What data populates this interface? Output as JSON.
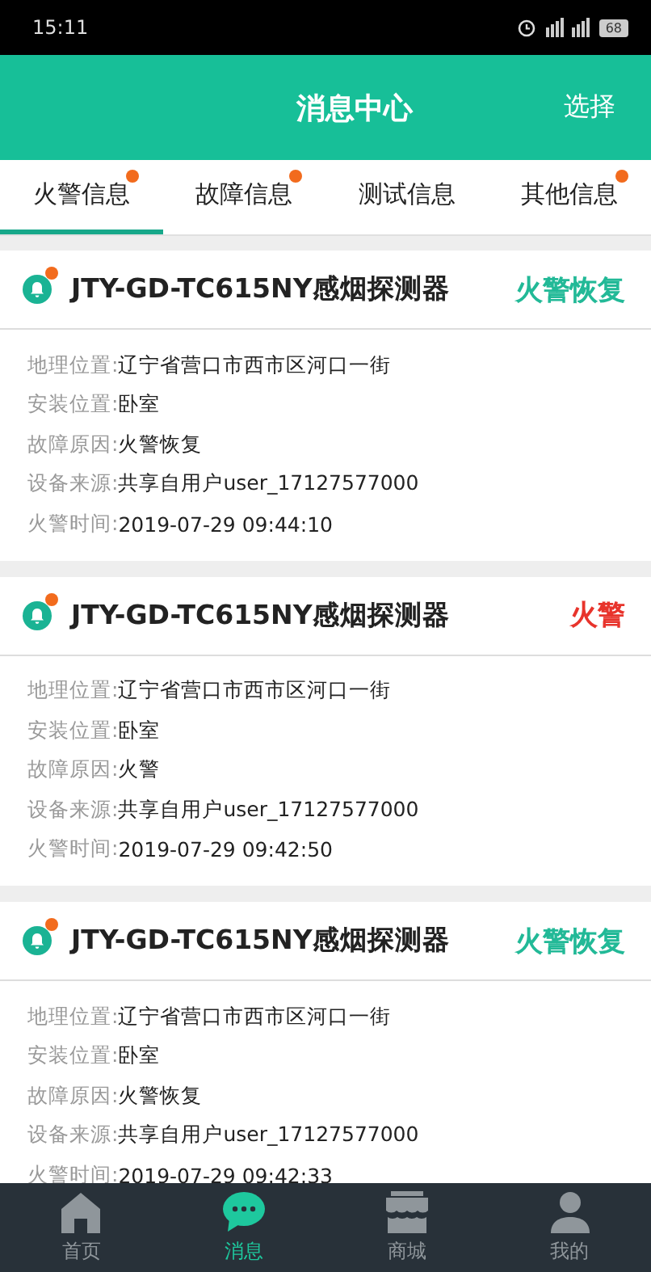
{
  "status_bar": {
    "time": "15:11",
    "battery": "68"
  },
  "header": {
    "title": "消息中心",
    "action": "选择"
  },
  "tabs": [
    {
      "label": "火警信息",
      "selected": true,
      "badge": true
    },
    {
      "label": "故障信息",
      "selected": false,
      "badge": true
    },
    {
      "label": "测试信息",
      "selected": false,
      "badge": false
    },
    {
      "label": "其他信息",
      "selected": false,
      "badge": true
    }
  ],
  "messages": [
    {
      "device": "JTY-GD-TC615NY感烟探测器",
      "unread": true,
      "status": "火警恢复",
      "kind": "restore",
      "fields": [
        {
          "label": "地理位置:",
          "value": "辽宁省营口市西市区河口一街"
        },
        {
          "label": "安装位置:",
          "value": "卧室"
        },
        {
          "label": "故障原因:",
          "value": "火警恢复"
        },
        {
          "label": "设备来源:",
          "value": "共享自用户user_17127577000"
        },
        {
          "label": "火警时间:",
          "value": "2019-07-29 09:44:10"
        }
      ]
    },
    {
      "device": "JTY-GD-TC615NY感烟探测器",
      "unread": true,
      "status": "火警",
      "kind": "alarm",
      "fields": [
        {
          "label": "地理位置:",
          "value": "辽宁省营口市西市区河口一街"
        },
        {
          "label": "安装位置:",
          "value": "卧室"
        },
        {
          "label": "故障原因:",
          "value": "火警"
        },
        {
          "label": "设备来源:",
          "value": "共享自用户user_17127577000"
        },
        {
          "label": "火警时间:",
          "value": "2019-07-29 09:42:50"
        }
      ]
    },
    {
      "device": "JTY-GD-TC615NY感烟探测器",
      "unread": true,
      "status": "火警恢复",
      "kind": "restore",
      "fields": [
        {
          "label": "地理位置:",
          "value": "辽宁省营口市西市区河口一街"
        },
        {
          "label": "安装位置:",
          "value": "卧室"
        },
        {
          "label": "故障原因:",
          "value": "火警恢复"
        },
        {
          "label": "设备来源:",
          "value": "共享自用户user_17127577000"
        },
        {
          "label": "火警时间:",
          "value": "2019-07-29 09:42:33"
        }
      ]
    }
  ],
  "nav": [
    {
      "label": "首页",
      "kind": "home",
      "selected": false
    },
    {
      "label": "消息",
      "kind": "chat",
      "selected": true
    },
    {
      "label": "商城",
      "kind": "shop",
      "selected": false
    },
    {
      "label": "我的",
      "kind": "person",
      "selected": false
    }
  ]
}
